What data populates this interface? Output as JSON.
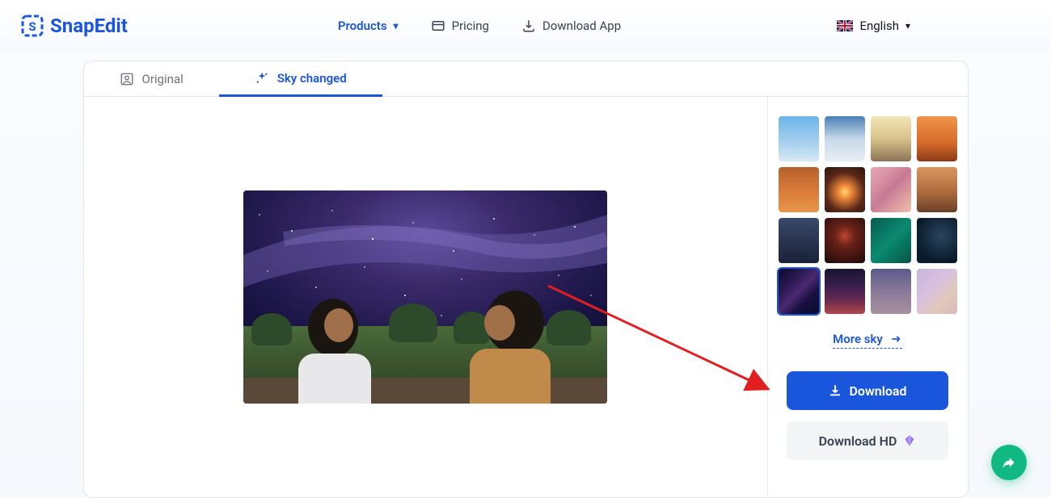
{
  "brand": {
    "name": "SnapEdit"
  },
  "nav": {
    "products": "Products",
    "pricing": "Pricing",
    "download_app": "Download App"
  },
  "lang": {
    "label": "English"
  },
  "tabs": {
    "original": "Original",
    "sky_changed": "Sky changed"
  },
  "sidebar": {
    "more_sky": "More sky",
    "download": "Download",
    "download_hd": "Download HD",
    "sky_options": [
      {
        "id": "blue-clouds",
        "css": "background: linear-gradient(180deg,#6bb5e8 0%,#a8d0ee 60%,#d8e9f5 100%);"
      },
      {
        "id": "cumulus",
        "css": "background: linear-gradient(180deg,#4a7fb5 0%,#c5d8e8 50%,#e8eef3 100%);"
      },
      {
        "id": "golden-haze",
        "css": "background: linear-gradient(180deg,#f5e6b8 0%,#d8c28a 50%,#8a7355 100%);"
      },
      {
        "id": "orange-sunset",
        "css": "background: linear-gradient(180deg,#f0944a 0%,#d56a2a 60%,#8a3a18 100%);"
      },
      {
        "id": "orange-clouds",
        "css": "background: linear-gradient(180deg,#b5602a 0%,#d87a3a 50%,#e8954a 100%);"
      },
      {
        "id": "sun-horizon",
        "css": "background: radial-gradient(circle at 50% 55%,#ffd870 0%,#f08a3a 20%,#5a2818 60%,#2a1510 100%);"
      },
      {
        "id": "pink-clouds",
        "css": "background: linear-gradient(135deg,#e8a8b5 0%,#c87a95 50%,#f0c0a8 100%);"
      },
      {
        "id": "amber-blur",
        "css": "background: linear-gradient(180deg,#d89560 0%,#b57040 50%,#6a4028 100%);"
      },
      {
        "id": "moon-dusk",
        "css": "background: linear-gradient(180deg,#3a4a6a 0%,#2a3550 50%,#1a2238 100%);"
      },
      {
        "id": "red-moon",
        "css": "background: radial-gradient(circle at 50% 40%,#c04530 0%,#6a2218 30%,#1a0a0a 100%);"
      },
      {
        "id": "teal-aurora",
        "css": "background: linear-gradient(135deg,#0a5a50 0%,#0a8a70 50%,#055545 100%);"
      },
      {
        "id": "dark-swirl",
        "css": "background: radial-gradient(circle at 60% 40%,#2a4560 0%,#0a1a2a 70%);"
      },
      {
        "id": "galaxy",
        "selected": true,
        "css": "background: linear-gradient(135deg,#0a0a2e 0%,#2a1850 30%,#4a2870 50%,#1a1040 70%,#0a0a2e 100%);"
      },
      {
        "id": "nebula",
        "css": "background: linear-gradient(180deg,#1a1530 0%,#3a2050 40%,#6a2a50 70%,#b04a4a 100%);"
      },
      {
        "id": "twilight",
        "css": "background: linear-gradient(180deg,#5a5a8a 0%,#8a7a9a 50%,#a890a0 100%);"
      },
      {
        "id": "pastel-rainbow",
        "css": "background: linear-gradient(135deg,#c8b5d8 0%,#d8c0e0 40%,#e0c8b8 70%,#d8b8c0 100%);"
      }
    ]
  }
}
